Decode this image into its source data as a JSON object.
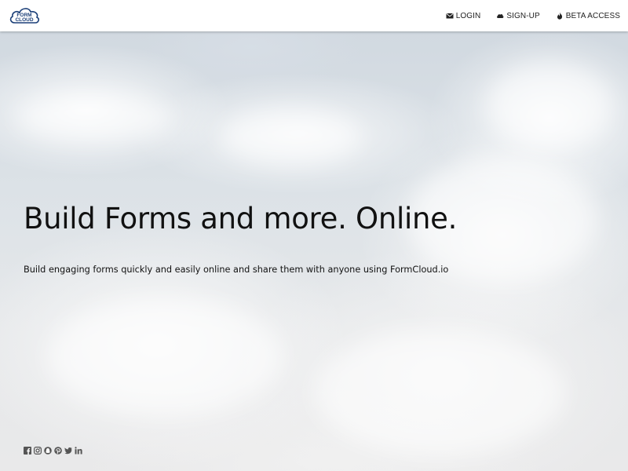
{
  "brand": {
    "logo_line1": "FORM",
    "logo_line2": "CLOUD",
    "logo_color": "#1b3f78"
  },
  "nav": {
    "items": [
      {
        "label": "LOGIN",
        "icon": "envelope-icon"
      },
      {
        "label": "SIGN-UP",
        "icon": "cloud-icon"
      },
      {
        "label": "BETA ACCESS",
        "icon": "fire-icon"
      }
    ]
  },
  "hero": {
    "headline": "Build Forms and more. Online.",
    "subtext": "Build engaging forms quickly and easily online and share them with anyone using FormCloud.io"
  },
  "social": {
    "icons": [
      "facebook-icon",
      "instagram-icon",
      "snapchat-icon",
      "pinterest-icon",
      "twitter-icon",
      "linkedin-icon"
    ]
  },
  "colors": {
    "text": "#111111",
    "navbar_bg": "#ffffff",
    "icon": "#555555"
  }
}
